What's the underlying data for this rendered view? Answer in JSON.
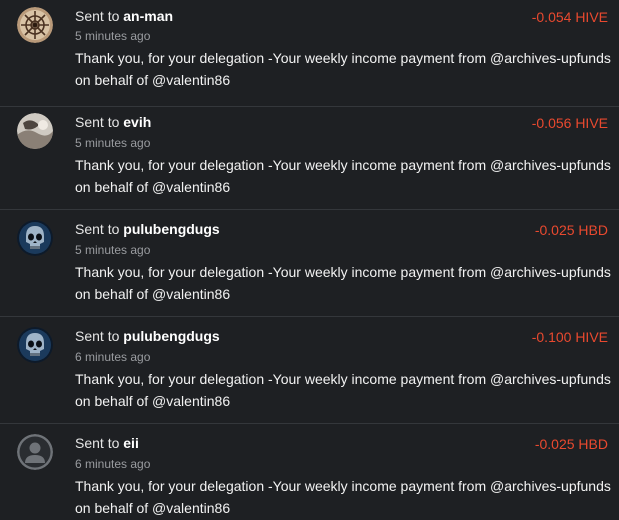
{
  "colors": {
    "background": "#1e2023",
    "divider": "#34373b",
    "amount_negative": "#e9492f",
    "muted": "#9a9ca0"
  },
  "transactions": [
    {
      "prefix": "Sent to",
      "user": "an-man",
      "time": "5 minutes ago",
      "amount": "-0.054 HIVE",
      "memo": "Thank you, for your delegation -Your weekly income payment from @archives-upfunds on behalf of @valentin86",
      "avatar_icon": "mandala-avatar-icon"
    },
    {
      "prefix": "Sent to",
      "user": "evih",
      "time": "5 minutes ago",
      "amount": "-0.056 HIVE",
      "memo": "Thank you, for your delegation -Your weekly income payment from @archives-upfunds on behalf of @valentin86",
      "avatar_icon": "photo-avatar-icon"
    },
    {
      "prefix": "Sent to",
      "user": "pulubengdugs",
      "time": "5 minutes ago",
      "amount": "-0.025 HBD",
      "memo": "Thank you, for your delegation -Your weekly income payment from @archives-upfunds on behalf of @valentin86",
      "avatar_icon": "skull-avatar-icon"
    },
    {
      "prefix": "Sent to",
      "user": "pulubengdugs",
      "time": "6 minutes ago",
      "amount": "-0.100 HIVE",
      "memo": "Thank you, for your delegation -Your weekly income payment from @archives-upfunds on behalf of @valentin86",
      "avatar_icon": "skull-avatar-icon"
    },
    {
      "prefix": "Sent to",
      "user": "eii",
      "time": "6 minutes ago",
      "amount": "-0.025 HBD",
      "memo": "Thank you, for your delegation -Your weekly income payment from @archives-upfunds on behalf of @valentin86",
      "avatar_icon": "default-user-avatar-icon"
    }
  ]
}
